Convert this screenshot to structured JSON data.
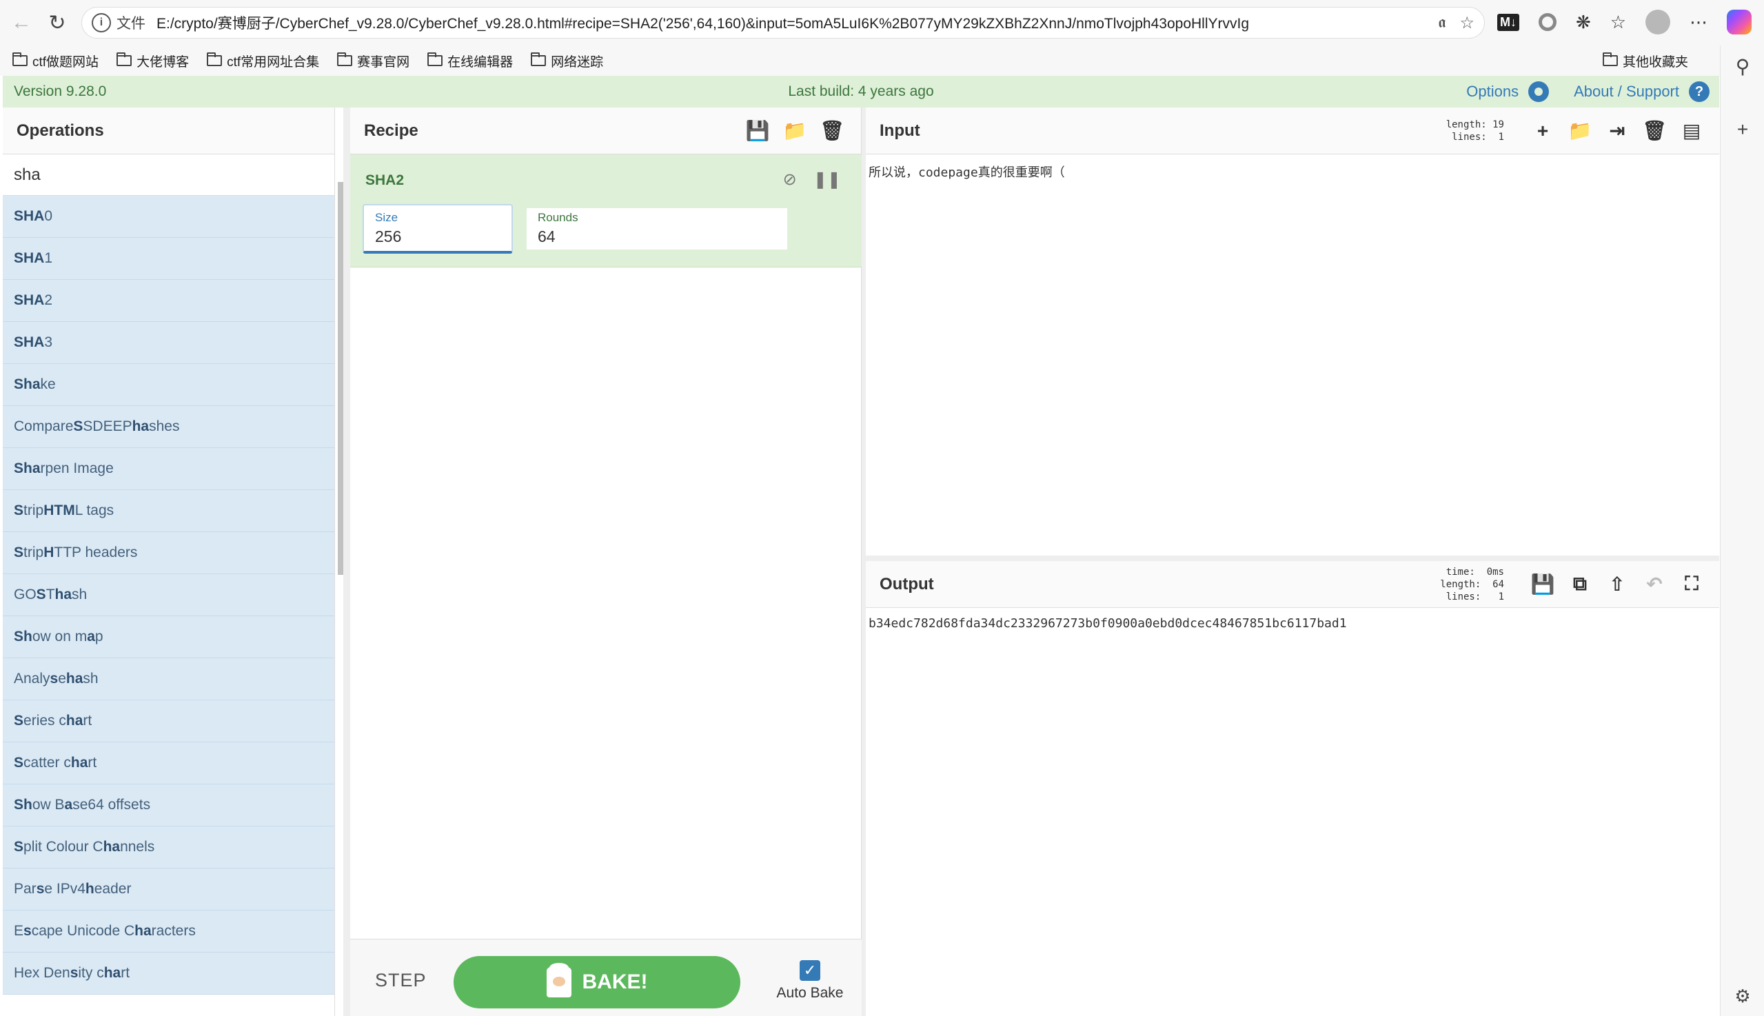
{
  "browser": {
    "address_scheme": "文件",
    "url": "E:/crypto/赛博厨子/CyberChef_v9.28.0/CyberChef_v9.28.0.html#recipe=SHA2('256',64,160)&input=5omA5LuI6K%2B077yMY29kZXBhZ2XnnJ/nmoTlvojph43opoHllYrvvIg",
    "bookmarks": [
      "ctf做题网站",
      "大佬博客",
      "ctf常用网址合集",
      "赛事官网",
      "在线编辑器",
      "网络迷踪"
    ],
    "other_bookmarks": "其他收藏夹"
  },
  "banner": {
    "version": "Version 9.28.0",
    "build": "Last build: 4 years ago",
    "options": "Options",
    "about": "About / Support"
  },
  "operations": {
    "title": "Operations",
    "search_value": "sha",
    "items": [
      {
        "h": "SHA",
        "r": "0"
      },
      {
        "h": "SHA",
        "r": "1"
      },
      {
        "h": "SHA",
        "r": "2"
      },
      {
        "h": "SHA",
        "r": "3"
      },
      {
        "h": "Sha",
        "r": "ke"
      },
      {
        "pre": "Compare ",
        "h": "S",
        "mid": "SDEEP ",
        "h2": "ha",
        "r": "shes"
      },
      {
        "h": "Sha",
        "r": "rpen Image"
      },
      {
        "h": "S",
        "mid": "trip ",
        "h2": "HTM",
        "r": "L tags"
      },
      {
        "h": "S",
        "mid": "trip ",
        "h2": "H",
        "r": "TTP headers"
      },
      {
        "pre": "GO",
        "h": "S",
        "mid": "T ",
        "h2": "ha",
        "r": "sh"
      },
      {
        "h": "Sh",
        "mid": "ow on m",
        "h2": "a",
        "r": "p"
      },
      {
        "pre": "Analy",
        "h": "s",
        "mid": "e ",
        "h2": "ha",
        "r": "sh"
      },
      {
        "h": "S",
        "mid": "eries c",
        "h2": "ha",
        "r": "rt"
      },
      {
        "h": "S",
        "mid": "catter c",
        "h2": "ha",
        "r": "rt"
      },
      {
        "h": "Sh",
        "mid": "ow B",
        "h2": "a",
        "r": "se64 offsets"
      },
      {
        "h": "S",
        "mid": "plit Colour C",
        "h2": "ha",
        "r": "nnels"
      },
      {
        "pre": "Par",
        "h": "s",
        "mid": "e IPv4 ",
        "h2": "h",
        "r": "eader"
      },
      {
        "pre": "E",
        "h": "s",
        "mid": "cape Unicode C",
        "h2": "ha",
        "r": "racters"
      },
      {
        "pre": "Hex Den",
        "h": "s",
        "mid": "ity c",
        "h2": "ha",
        "r": "rt"
      }
    ]
  },
  "recipe": {
    "title": "Recipe",
    "operation": {
      "name": "SHA2",
      "size_label": "Size",
      "size_value": "256",
      "rounds_label": "Rounds",
      "rounds_value": "64"
    },
    "step_label": "STEP",
    "bake_label": "BAKE!",
    "auto_bake_label": "Auto Bake"
  },
  "input": {
    "title": "Input",
    "stats": "length: 19\n lines:  1",
    "text": "所以说，codepage真的很重要啊（"
  },
  "output": {
    "title": "Output",
    "stats": "  time:  0ms\nlength:  64\n lines:   1",
    "text": "b34edc782d68fda34dc2332967273b0f0900a0ebd0dcec48467851bc6117bad1"
  }
}
